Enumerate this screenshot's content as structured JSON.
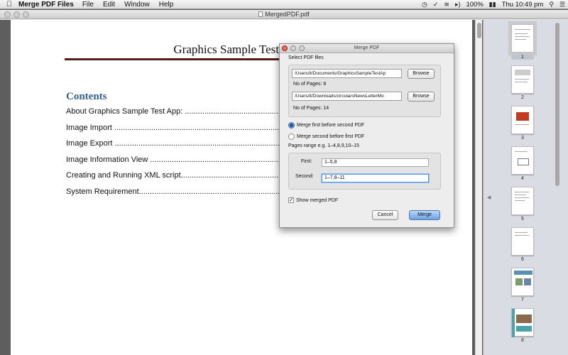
{
  "menubar": {
    "app_name": "Merge PDF Files",
    "items": [
      "File",
      "Edit",
      "Window",
      "Help"
    ],
    "battery": "100%",
    "clock": "Thu 10:49 pm"
  },
  "window": {
    "title": "MergedPDF.pdf"
  },
  "document": {
    "title": "Graphics Sample Test App",
    "contents_heading": "Contents",
    "toc": [
      "About Graphics Sample Test App: ..........................................................",
      "Image Import ...................................................................................",
      "Image Export ...................................................................................",
      "Image Information View .....................................................................",
      "Creating and Running XML script...........................................................",
      "System Requirement.............................................................................."
    ]
  },
  "thumbnails": [
    "1",
    "2",
    "3",
    "4",
    "5",
    "6",
    "7",
    "8"
  ],
  "dialog": {
    "title": "Merge PDF",
    "select_label": "Select PDF files",
    "file1_path": "/Users/it/Documents/GraphicsSampleTestAp",
    "file1_pages": "No of Pages:  8",
    "file2_path": "/Users/it/Downloads/circularsNewsLetterMo",
    "file2_pages": "No of Pages:  14",
    "browse_label": "Browse",
    "radio1_label": "Merge first before second PDF",
    "radio2_label": "Merge second before first PDF",
    "range_hint": "Pages range e.g. 1–4,8,9,10–15",
    "first_label": "First:",
    "first_value": "1–5,8",
    "second_label": "Second:",
    "second_value": "1–7,8–11",
    "show_merged_label": "Show merged PDF",
    "cancel_label": "Cancel",
    "merge_label": "Merge"
  }
}
